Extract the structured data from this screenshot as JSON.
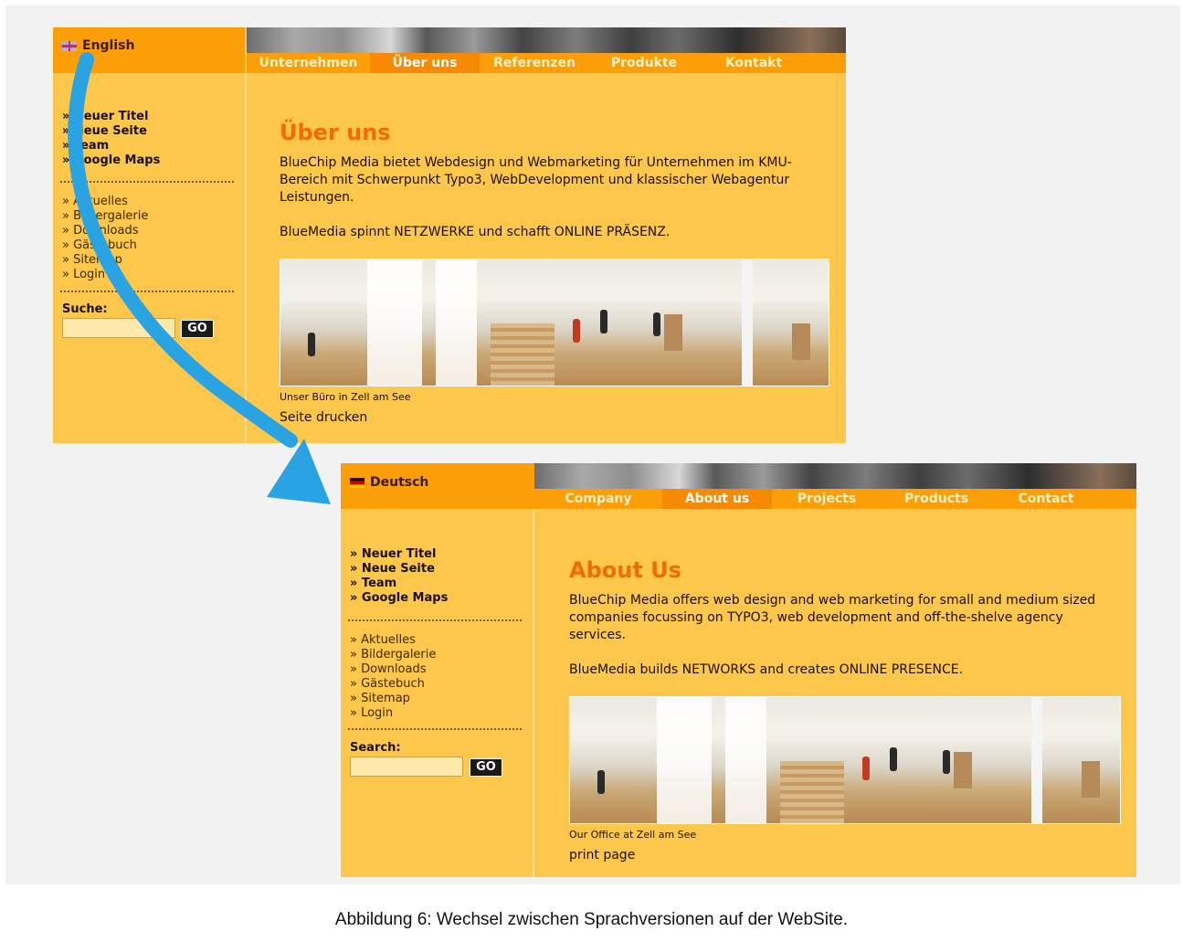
{
  "top": {
    "lang_link": "English",
    "nav": [
      "Unternehmen",
      "Über uns",
      "Referenzen",
      "Produkte",
      "Kontakt"
    ],
    "menu_main": [
      "» Neuer Titel",
      "» Neue Seite",
      "» Team",
      "» Google Maps"
    ],
    "menu_sub": [
      "» Aktuelles",
      "» Bildergalerie",
      "» Downloads",
      "» Gästebuch",
      "» Sitemap",
      "» Login"
    ],
    "search_label": "Suche:",
    "go": "GO",
    "title": "Über uns",
    "para1": "BlueChip Media bietet Webdesign und Webmarketing für Unternehmen im KMU-Bereich mit Schwerpunkt Typo3, WebDevelopment und klassischer Webagentur Leistungen.",
    "para2": "BlueMedia spinnt NETZWERKE und schafft ONLINE PRÄSENZ.",
    "caption": "Unser Büro in Zell am See",
    "print": "Seite drucken"
  },
  "bottom": {
    "lang_link": "Deutsch",
    "nav": [
      "Company",
      "About us",
      "Projects",
      "Products",
      "Contact"
    ],
    "menu_main": [
      "» Neuer Titel",
      "» Neue Seite",
      "» Team",
      "» Google Maps"
    ],
    "menu_sub": [
      "» Aktuelles",
      "» Bildergalerie",
      "» Downloads",
      "» Gästebuch",
      "» Sitemap",
      "» Login"
    ],
    "search_label": "Search:",
    "go": "GO",
    "title": "About Us",
    "para1": "BlueChip Media offers web design and web marketing for small and medium sized companies focussing on TYPO3, web development and off-the-shelve agency services.",
    "para2": "BlueMedia builds NETWORKS and creates ONLINE PRESENCE.",
    "caption": "Our Office at Zell am See",
    "print": "print page"
  },
  "figure_caption": "Abbildung 6: Wechsel zwischen Sprachversionen auf der WebSite.",
  "colors": {
    "accent": "#fb9e08",
    "background": "#fcc74a",
    "title": "#f46b05",
    "arrow": "#2aa3e3"
  }
}
